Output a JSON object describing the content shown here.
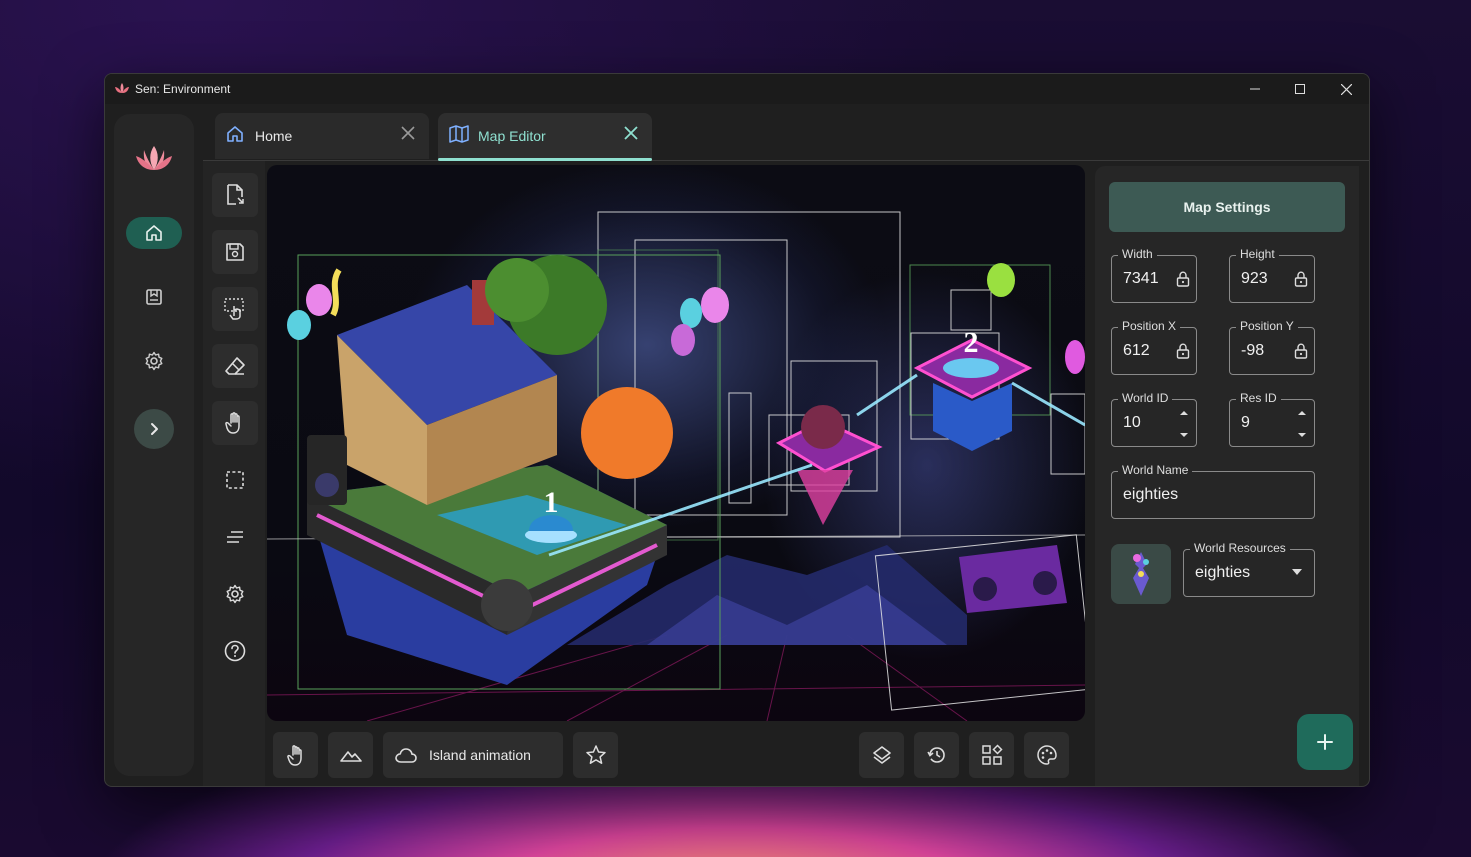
{
  "window": {
    "title": "Sen: Environment"
  },
  "tabs": [
    {
      "label": "Home",
      "icon": "home-icon",
      "active": false
    },
    {
      "label": "Map Editor",
      "icon": "map-icon",
      "active": true
    }
  ],
  "canvas": {
    "markers": [
      "1",
      "2"
    ]
  },
  "bottom_toolbar": {
    "animation_label": "Island animation"
  },
  "panel": {
    "title": "Map Settings",
    "width": {
      "label": "Width",
      "value": "7341"
    },
    "height": {
      "label": "Height",
      "value": "923"
    },
    "pos_x": {
      "label": "Position X",
      "value": "612"
    },
    "pos_y": {
      "label": "Position Y",
      "value": "-98"
    },
    "world_id": {
      "label": "World ID",
      "value": "10"
    },
    "res_id": {
      "label": "Res ID",
      "value": "9"
    },
    "world_name": {
      "label": "World Name",
      "value": "eighties"
    },
    "world_resources": {
      "label": "World Resources",
      "value": "eighties"
    }
  },
  "colors": {
    "accent": "#8fe0d0",
    "active_rail": "#1f5f52",
    "fab": "#1f6b5b"
  }
}
